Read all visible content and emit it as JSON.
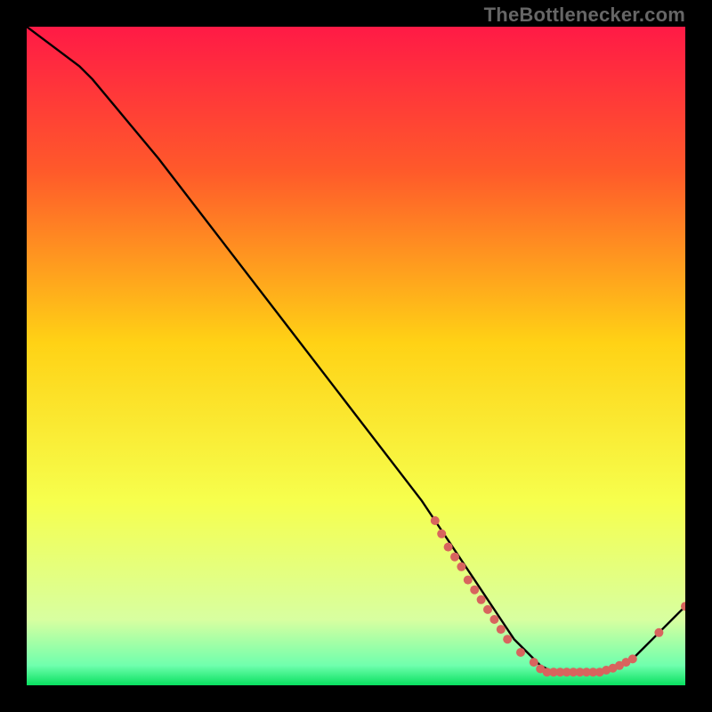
{
  "attribution": "TheBottlenecker.com",
  "colors": {
    "bg": "#000000",
    "grad_top": "#ff1a46",
    "grad_upper": "#ff5a2a",
    "grad_mid": "#ffd215",
    "grad_lower": "#f6ff4d",
    "grad_pale": "#d8ffa0",
    "grad_green": "#09e060",
    "curve": "#000000",
    "marker": "#d8645e"
  },
  "chart_data": {
    "type": "line",
    "title": "",
    "xlabel": "",
    "ylabel": "",
    "xlim": [
      0,
      100
    ],
    "ylim": [
      0,
      100
    ],
    "series": [
      {
        "name": "bottleneck-curve",
        "x": [
          0,
          4,
          8,
          10,
          15,
          20,
          30,
          40,
          50,
          60,
          62,
          64,
          66,
          68,
          70,
          72,
          74,
          76,
          78,
          80,
          82,
          84,
          86,
          88,
          90,
          92,
          94,
          96,
          98,
          100
        ],
        "y": [
          100,
          97,
          94,
          92,
          86,
          80,
          67,
          54,
          41,
          28,
          25,
          22,
          19,
          16,
          13,
          10,
          7,
          5,
          3,
          2,
          2,
          2,
          2,
          2,
          3,
          4,
          6,
          8,
          10,
          12
        ]
      }
    ],
    "markers": {
      "name": "salmon-dots",
      "points": [
        {
          "x": 62,
          "y": 25
        },
        {
          "x": 63,
          "y": 23
        },
        {
          "x": 64,
          "y": 21
        },
        {
          "x": 65,
          "y": 19.5
        },
        {
          "x": 66,
          "y": 18
        },
        {
          "x": 67,
          "y": 16
        },
        {
          "x": 68,
          "y": 14.5
        },
        {
          "x": 69,
          "y": 13
        },
        {
          "x": 70,
          "y": 11.5
        },
        {
          "x": 71,
          "y": 10
        },
        {
          "x": 72,
          "y": 8.5
        },
        {
          "x": 73,
          "y": 7
        },
        {
          "x": 75,
          "y": 5
        },
        {
          "x": 77,
          "y": 3.5
        },
        {
          "x": 78,
          "y": 2.5
        },
        {
          "x": 79,
          "y": 2
        },
        {
          "x": 80,
          "y": 2
        },
        {
          "x": 81,
          "y": 2
        },
        {
          "x": 82,
          "y": 2
        },
        {
          "x": 83,
          "y": 2
        },
        {
          "x": 84,
          "y": 2
        },
        {
          "x": 85,
          "y": 2
        },
        {
          "x": 86,
          "y": 2
        },
        {
          "x": 87,
          "y": 2
        },
        {
          "x": 88,
          "y": 2.3
        },
        {
          "x": 89,
          "y": 2.6
        },
        {
          "x": 90,
          "y": 3
        },
        {
          "x": 91,
          "y": 3.5
        },
        {
          "x": 92,
          "y": 4
        },
        {
          "x": 96,
          "y": 8
        },
        {
          "x": 100,
          "y": 12
        }
      ]
    }
  }
}
